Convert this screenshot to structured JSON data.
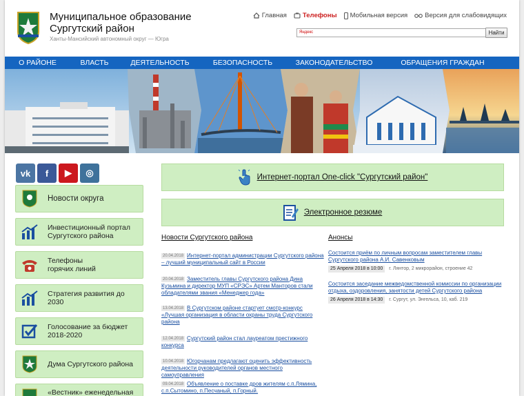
{
  "header": {
    "title_line1": "Муниципальное образование",
    "title_line2": "Сургутский район",
    "subtitle": "Ханты-Мансийский автономный округ — Югра",
    "links": [
      {
        "label": "Главная",
        "icon": "home-icon"
      },
      {
        "label": "Телефоны",
        "icon": "phone-icon"
      },
      {
        "label": "Мобильная версия",
        "icon": "mobile-icon"
      },
      {
        "label": "Версия для слабовидящих",
        "icon": "glasses-icon"
      }
    ],
    "search_placeholder": "Яндекс",
    "search_button": "Найти"
  },
  "nav": [
    "О РАЙОНЕ",
    "ВЛАСТЬ",
    "ДЕЯТЕЛЬНОСТЬ",
    "БЕЗОПАСНОСТЬ",
    "ЗАКОНОДАТЕЛЬСТВО",
    "ОБРАЩЕНИЯ ГРАЖДАН"
  ],
  "social": [
    {
      "name": "vk",
      "label": "vk",
      "color": "#4c75a3"
    },
    {
      "name": "facebook",
      "label": "f",
      "color": "#3b5998"
    },
    {
      "name": "youtube",
      "label": "▶",
      "color": "#cc181e"
    },
    {
      "name": "instagram",
      "label": "◎",
      "color": "#3f729b"
    }
  ],
  "sidebar": [
    {
      "l1": "Новости округа",
      "l2": "",
      "icon": "emblem-icon"
    },
    {
      "l1": "Инвестиционный портал",
      "l2": "Сургутского района",
      "icon": "chart-icon"
    },
    {
      "l1": "Телефоны",
      "l2": "горячих линий",
      "icon": "phone-icon"
    },
    {
      "l1": "Стратегия развития до",
      "l2": "2030",
      "icon": "chart-icon"
    },
    {
      "l1": "Голосование за бюджет",
      "l2": "2018-2020",
      "icon": "checkbox-icon"
    },
    {
      "l1": "Дума Сургутского района",
      "l2": "",
      "icon": "emblem-icon"
    },
    {
      "l1": "«Вестник» еженедельная",
      "l2": "",
      "icon": "emblem-icon"
    }
  ],
  "main": {
    "portal_label": "Интернет-портал One-click \"Сургутский район\"",
    "resume_label": "Электронное резюме",
    "news_title": "Новости Сургутского района",
    "announce_title": "Анонсы",
    "news": [
      {
        "date": "20.04.2018",
        "text": "Интернет-портал администрации Сургутского района – лучший муниципальный сайт в России"
      },
      {
        "date": "20.04.2018",
        "text": "Заместитель главы Сургутского района Дина Кузьмина и директор МУП «СРЭС» Артем Манторов стали обладателями звания «Менеджер года»"
      },
      {
        "date": "13.04.2018",
        "text": "В Сургутском районе стартует смотр-конкурс «Лучшая организация в области охраны труда Сургутского района"
      },
      {
        "date": "12.04.2018",
        "text": "Сургутский район стал лауреатом престижного конкурса"
      },
      {
        "date": "10.04.2018",
        "text": "Югорчанам предлагают оценить эффективность деятельности руководителей органов местного самоуправления"
      },
      {
        "date": "09.04.2018",
        "text": "Объявление о поставке дров жителям с.п.Лямина, с.п.Сытомино, п.Песчаный, п.Горный."
      }
    ],
    "announces": [
      {
        "text": "Состоится приём по личным вопросам заместителем главы Сургутского района А.И. Савенковым",
        "date": "25 Апреля 2018 в 10:00",
        "place": "г. Лянтор, 2 микрорайон, строение 42"
      },
      {
        "text": "Состоится заседание межведомственной комиссии по организации отдыха, оздоровления, занятости детей Сургутского района",
        "date": "26 Апреля 2018 в 14:30",
        "place": "г. Сургут, ул. Энгельса, 10, каб. 219"
      }
    ]
  },
  "colors": {
    "nav": "#1565c0",
    "green_btn": "#cfeec2",
    "link": "#1a4fa0",
    "accent_red": "#cc1f1f"
  }
}
